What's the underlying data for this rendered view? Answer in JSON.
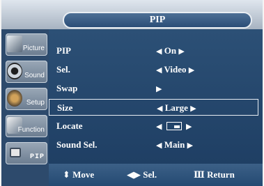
{
  "title": "PIP",
  "sidebar": {
    "items": [
      {
        "label": "Picture",
        "icon": "picture-icon"
      },
      {
        "label": "Sound",
        "icon": "speaker-icon"
      },
      {
        "label": "Setup",
        "icon": "setup-icon"
      },
      {
        "label": "Function",
        "icon": "function-icon"
      },
      {
        "label": "PIP",
        "icon": "pip-icon"
      }
    ]
  },
  "menu": {
    "rows": [
      {
        "label": "PIP",
        "value": "On"
      },
      {
        "label": "Sel.",
        "value": "Video"
      },
      {
        "label": "Swap",
        "value": ""
      },
      {
        "label": "Size",
        "value": "Large",
        "selected": true
      },
      {
        "label": "Locate",
        "value": ""
      },
      {
        "label": "Sound Sel.",
        "value": "Main"
      }
    ]
  },
  "footer": {
    "move": "Move",
    "sel": "Sel.",
    "return": "Return"
  },
  "colors": {
    "panel": "#244a72",
    "sidebar": "#2d4a6c",
    "text": "#ffffff"
  }
}
